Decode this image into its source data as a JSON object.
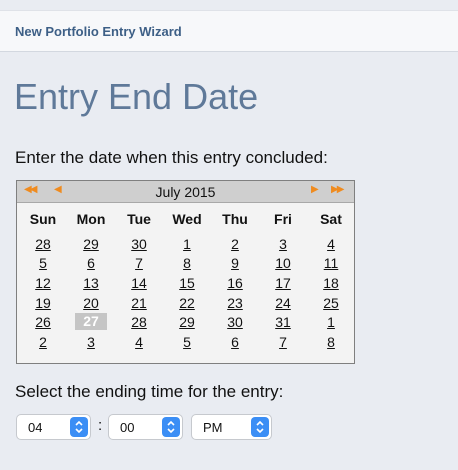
{
  "wizard": {
    "title": "New Portfolio Entry Wizard"
  },
  "page": {
    "title": "Entry End Date",
    "instruction": "Enter the date when this entry concluded:",
    "time_label": "Select the ending time for the entry:"
  },
  "calendar": {
    "nav": {
      "prev_year": "◀◀",
      "prev_month": "◀",
      "next_month": "▶",
      "next_year": "▶▶"
    },
    "month_label": "July 2015",
    "weekdays": [
      "Sun",
      "Mon",
      "Tue",
      "Wed",
      "Thu",
      "Fri",
      "Sat"
    ],
    "weeks": [
      [
        "28",
        "29",
        "30",
        "1",
        "2",
        "3",
        "4"
      ],
      [
        "5",
        "6",
        "7",
        "8",
        "9",
        "10",
        "11"
      ],
      [
        "12",
        "13",
        "14",
        "15",
        "16",
        "17",
        "18"
      ],
      [
        "19",
        "20",
        "21",
        "22",
        "23",
        "24",
        "25"
      ],
      [
        "26",
        "27",
        "28",
        "29",
        "30",
        "31",
        "1"
      ],
      [
        "2",
        "3",
        "4",
        "5",
        "6",
        "7",
        "8"
      ]
    ],
    "selected_day": "27"
  },
  "time": {
    "hour": "04",
    "separator": ":",
    "minute": "00",
    "ampm": "PM"
  },
  "colors": {
    "accent": "#3b8ef5",
    "nav_arrows": "#ef8b1f",
    "title": "#5f7999"
  }
}
